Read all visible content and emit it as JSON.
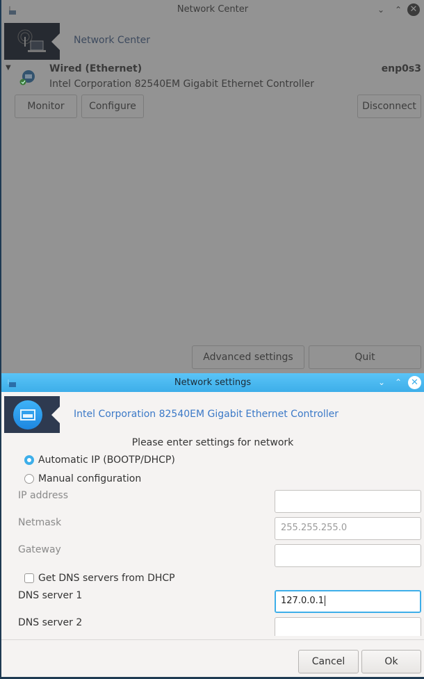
{
  "background_window": {
    "title": "Network Center",
    "header_label": "Network Center",
    "connection": {
      "type_label": "Wired (Ethernet)",
      "interface": "enp0s3",
      "device": "Intel Corporation 82540EM Gigabit Ethernet Controller",
      "status": "connected"
    },
    "buttons": {
      "monitor": "Monitor",
      "configure": "Configure",
      "disconnect": "Disconnect",
      "advanced": "Advanced settings",
      "quit": "Quit"
    }
  },
  "dialog": {
    "title": "Network settings",
    "header_label": "Intel Corporation 82540EM Gigabit Ethernet Controller",
    "prompt": "Please enter settings for network",
    "mode_options": [
      {
        "label": "Automatic IP (BOOTP/DHCP)",
        "selected": true
      },
      {
        "label": "Manual configuration",
        "selected": false
      }
    ],
    "fields": {
      "ip_label": "IP address",
      "ip_value": "",
      "netmask_label": "Netmask",
      "netmask_value": "255.255.255.0",
      "gateway_label": "Gateway",
      "gateway_value": "",
      "dns_dhcp_label": "Get DNS servers from DHCP",
      "dns_dhcp_checked": false,
      "dns1_label": "DNS server 1",
      "dns1_value": "127.0.0.1",
      "dns2_label": "DNS server 2",
      "dns2_value": ""
    },
    "buttons": {
      "cancel": "Cancel",
      "ok": "Ok"
    }
  },
  "colors": {
    "accent": "#3daee9",
    "banner_dark": "#262a31",
    "dialog_banner": "#2e3a50"
  }
}
